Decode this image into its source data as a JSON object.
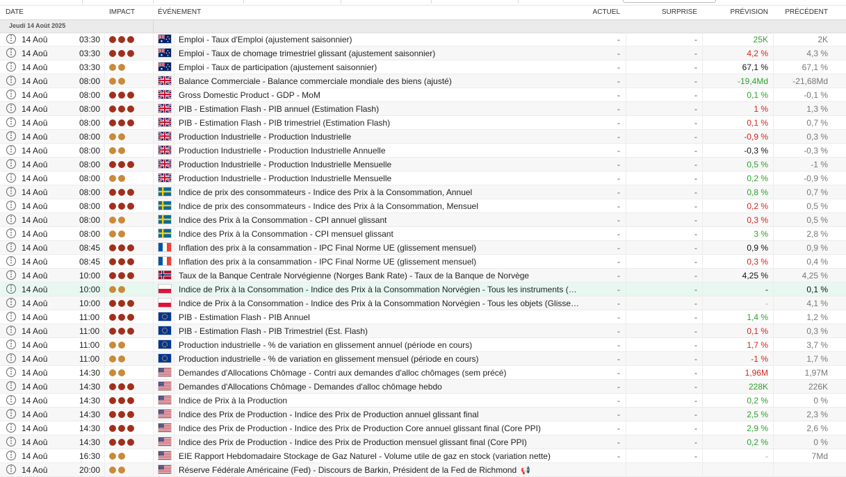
{
  "columns": {
    "date": "DATE",
    "impact": "IMPACT",
    "event": "ÉVÉNEMENT",
    "actual": "ACTUEL",
    "surprise": "SURPRISE",
    "forecast": "PRÉVISION",
    "previous": "PRÉCÉDENT"
  },
  "group_label": "Jeudi 14 Août 2025",
  "colors": {
    "impact_high": "#a0301c",
    "impact_medium": "#c98a3a",
    "forecast_up": "#2ea02e",
    "forecast_down": "#d0251e",
    "highlight_row": "#e7f8f1"
  },
  "rows": [
    {
      "date": "14 Aoû",
      "time": "03:30",
      "impact": 3,
      "flag": "australia",
      "event": "Emploi - Taux d'Emploi (ajustement saisonnier)",
      "actual": "-",
      "surprise": "-",
      "forecast": "25K",
      "forecast_color": "green",
      "previous": "2K"
    },
    {
      "date": "14 Aoû",
      "time": "03:30",
      "impact": 3,
      "flag": "australia",
      "event": "Emploi - Taux de chomage trimestriel glissant (ajustement saisonnier)",
      "actual": "-",
      "surprise": "-",
      "forecast": "4,2 %",
      "forecast_color": "red",
      "previous": "4,3 %"
    },
    {
      "date": "14 Aoû",
      "time": "03:30",
      "impact": 2,
      "flag": "australia",
      "event": "Emploi - Taux de participation (ajustement saisonnier)",
      "actual": "-",
      "surprise": "-",
      "forecast": "67,1 %",
      "forecast_color": "black",
      "previous": "67,1 %"
    },
    {
      "date": "14 Aoû",
      "time": "08:00",
      "impact": 2,
      "flag": "uk",
      "event": "Balance Commerciale - Balance commerciale mondiale des biens (ajusté)",
      "actual": "-",
      "surprise": "-",
      "forecast": "-19,4Md",
      "forecast_color": "green",
      "previous": "-21,68Md"
    },
    {
      "date": "14 Aoû",
      "time": "08:00",
      "impact": 3,
      "flag": "uk",
      "event": "Gross Domestic Product - GDP - MoM",
      "actual": "-",
      "surprise": "-",
      "forecast": "0,1 %",
      "forecast_color": "green",
      "previous": "-0,1 %"
    },
    {
      "date": "14 Aoû",
      "time": "08:00",
      "impact": 3,
      "flag": "uk",
      "event": "PIB - Estimation Flash - PIB annuel (Estimation Flash)",
      "actual": "-",
      "surprise": "-",
      "forecast": "1 %",
      "forecast_color": "red",
      "previous": "1,3 %"
    },
    {
      "date": "14 Aoû",
      "time": "08:00",
      "impact": 3,
      "flag": "uk",
      "event": "PIB - Estimation Flash - PIB trimestriel (Estimation Flash)",
      "actual": "-",
      "surprise": "-",
      "forecast": "0,1 %",
      "forecast_color": "red",
      "previous": "0,7 %"
    },
    {
      "date": "14 Aoû",
      "time": "08:00",
      "impact": 2,
      "flag": "uk",
      "event": "Production Industrielle - Production Industrielle",
      "actual": "-",
      "surprise": "-",
      "forecast": "-0,9 %",
      "forecast_color": "red",
      "previous": "0,3 %"
    },
    {
      "date": "14 Aoû",
      "time": "08:00",
      "impact": 2,
      "flag": "uk",
      "event": "Production Industrielle - Production Industrielle Annuelle",
      "actual": "-",
      "surprise": "-",
      "forecast": "-0,3 %",
      "forecast_color": "black",
      "previous": "-0,3 %"
    },
    {
      "date": "14 Aoû",
      "time": "08:00",
      "impact": 3,
      "flag": "uk",
      "event": "Production Industrielle - Production Industrielle Mensuelle",
      "actual": "-",
      "surprise": "-",
      "forecast": "0,5 %",
      "forecast_color": "green",
      "previous": "-1 %"
    },
    {
      "date": "14 Aoû",
      "time": "08:00",
      "impact": 2,
      "flag": "uk",
      "event": "Production Industrielle - Production Industrielle Mensuelle",
      "actual": "-",
      "surprise": "-",
      "forecast": "0,2 %",
      "forecast_color": "green",
      "previous": "-0,9 %"
    },
    {
      "date": "14 Aoû",
      "time": "08:00",
      "impact": 3,
      "flag": "sweden",
      "event": "Indice de prix des consommateurs - Indice des Prix à la Consommation, Annuel",
      "actual": "-",
      "surprise": "-",
      "forecast": "0,8 %",
      "forecast_color": "green",
      "previous": "0,7 %"
    },
    {
      "date": "14 Aoû",
      "time": "08:00",
      "impact": 3,
      "flag": "sweden",
      "event": "Indice de prix des consommateurs - Indice des Prix à la Consommation, Mensuel",
      "actual": "-",
      "surprise": "-",
      "forecast": "0,2 %",
      "forecast_color": "red",
      "previous": "0,5 %"
    },
    {
      "date": "14 Aoû",
      "time": "08:00",
      "impact": 2,
      "flag": "sweden",
      "event": "Indice des Prix à la Consommation - CPI annuel glissant",
      "actual": "-",
      "surprise": "-",
      "forecast": "0,3 %",
      "forecast_color": "red",
      "previous": "0,5 %"
    },
    {
      "date": "14 Aoû",
      "time": "08:00",
      "impact": 2,
      "flag": "sweden",
      "event": "Indice des Prix à la Consommation - CPI mensuel glissant",
      "actual": "-",
      "surprise": "-",
      "forecast": "3 %",
      "forecast_color": "green",
      "previous": "2,8 %"
    },
    {
      "date": "14 Aoû",
      "time": "08:45",
      "impact": 3,
      "flag": "france",
      "event": "Inflation des prix à la consammation - IPC Final Norme UE (glissement mensuel)",
      "actual": "-",
      "surprise": "-",
      "forecast": "0,9 %",
      "forecast_color": "black",
      "previous": "0,9 %"
    },
    {
      "date": "14 Aoû",
      "time": "08:45",
      "impact": 3,
      "flag": "france",
      "event": "Inflation des prix à la consammation - IPC Final Norme UE (glissement mensuel)",
      "actual": "-",
      "surprise": "-",
      "forecast": "0,3 %",
      "forecast_color": "red",
      "previous": "0,4 %"
    },
    {
      "date": "14 Aoû",
      "time": "10:00",
      "impact": 3,
      "flag": "norway",
      "event": "Taux de la Banque Centrale Norvégienne (Norges Bank Rate) - Taux de la Banque de Norvège",
      "actual": "-",
      "surprise": "-",
      "forecast": "4,25 %",
      "forecast_color": "black",
      "previous": "4,25 %"
    },
    {
      "date": "14 Aoû",
      "time": "10:00",
      "impact": 2,
      "flag": "poland",
      "event": "Indice de Prix à la Consommation - Indice des Prix à la Consommation Norvégien - Tous les instruments (…",
      "actual": "-",
      "surprise": "-",
      "forecast": "-",
      "forecast_color": "black",
      "previous": "0,1 %",
      "highlight": true
    },
    {
      "date": "14 Aoû",
      "time": "10:00",
      "impact": 3,
      "flag": "poland",
      "event": "Indice de Prix à la Consommation - Indice des Prix à la Consommation Norvégien - Tous les objets (Glisse…",
      "actual": "-",
      "surprise": "-",
      "forecast": "-",
      "forecast_color": "lgray",
      "previous": "4,1 %"
    },
    {
      "date": "14 Aoû",
      "time": "11:00",
      "impact": 3,
      "flag": "eu",
      "event": "PIB - Estimation Flash - PIB Annuel",
      "actual": "-",
      "surprise": "-",
      "forecast": "1,4 %",
      "forecast_color": "green",
      "previous": "1,2 %"
    },
    {
      "date": "14 Aoû",
      "time": "11:00",
      "impact": 3,
      "flag": "eu",
      "event": "PIB - Estimation Flash - PIB Trimestriel (Est. Flash)",
      "actual": "-",
      "surprise": "-",
      "forecast": "0,1 %",
      "forecast_color": "red",
      "previous": "0,3 %"
    },
    {
      "date": "14 Aoû",
      "time": "11:00",
      "impact": 2,
      "flag": "eu",
      "event": "Production industrielle - % de variation en glissement annuel (période en cours)",
      "actual": "-",
      "surprise": "-",
      "forecast": "1,7 %",
      "forecast_color": "red",
      "previous": "3,7 %"
    },
    {
      "date": "14 Aoû",
      "time": "11:00",
      "impact": 2,
      "flag": "eu",
      "event": "Production industrielle - % de variation en glissement mensuel (période en cours)",
      "actual": "-",
      "surprise": "-",
      "forecast": "-1 %",
      "forecast_color": "red",
      "previous": "1,7 %"
    },
    {
      "date": "14 Aoû",
      "time": "14:30",
      "impact": 2,
      "flag": "usa",
      "event": "Demandes d'Allocations Chômage - Contri aux demandes d'alloc chômages (sem précé)",
      "actual": "-",
      "surprise": "-",
      "forecast": "1,96M",
      "forecast_color": "red",
      "previous": "1,97M"
    },
    {
      "date": "14 Aoû",
      "time": "14:30",
      "impact": 3,
      "flag": "usa",
      "event": "Demandes d'Allocations Chômage - Demandes d'alloc chômage hebdo",
      "actual": "-",
      "surprise": "-",
      "forecast": "228K",
      "forecast_color": "green",
      "previous": "226K"
    },
    {
      "date": "14 Aoû",
      "time": "14:30",
      "impact": 3,
      "flag": "usa",
      "event": "Indice de Prix à la Production",
      "actual": "-",
      "surprise": "-",
      "forecast": "0,2 %",
      "forecast_color": "green",
      "previous": "0 %"
    },
    {
      "date": "14 Aoû",
      "time": "14:30",
      "impact": 3,
      "flag": "usa",
      "event": "Indice des Prix de Production - Indice des Prix de Production annuel glissant final",
      "actual": "-",
      "surprise": "-",
      "forecast": "2,5 %",
      "forecast_color": "green",
      "previous": "2,3 %"
    },
    {
      "date": "14 Aoû",
      "time": "14:30",
      "impact": 3,
      "flag": "usa",
      "event": "Indice des Prix de Production - Indice des Prix de Production Core annuel glissant final (Core PPI)",
      "actual": "-",
      "surprise": "-",
      "forecast": "2,9 %",
      "forecast_color": "green",
      "previous": "2,6 %"
    },
    {
      "date": "14 Aoû",
      "time": "14:30",
      "impact": 3,
      "flag": "usa",
      "event": "Indice des Prix de Production - Indice des Prix de Production mensuel glissant final (Core PPI)",
      "actual": "-",
      "surprise": "-",
      "forecast": "0,2 %",
      "forecast_color": "green",
      "previous": "0 %"
    },
    {
      "date": "14 Aoû",
      "time": "16:30",
      "impact": 2,
      "flag": "usa",
      "event": "EIE Rapport Hebdomadaire Stockage de Gaz Naturel - Volume utile de gaz en stock (variation nette)",
      "actual": "-",
      "surprise": "-",
      "forecast": "-",
      "forecast_color": "lgray",
      "previous": "7Md"
    },
    {
      "date": "14 Aoû",
      "time": "20:00",
      "impact": 2,
      "flag": "usa",
      "event": "Réserve Fédérale Américaine (Fed) - Discours de Barkin, Président de la Fed de Richmond",
      "actual": "",
      "surprise": "",
      "forecast": "",
      "forecast_color": "black",
      "previous": "",
      "megaphone": true
    }
  ]
}
